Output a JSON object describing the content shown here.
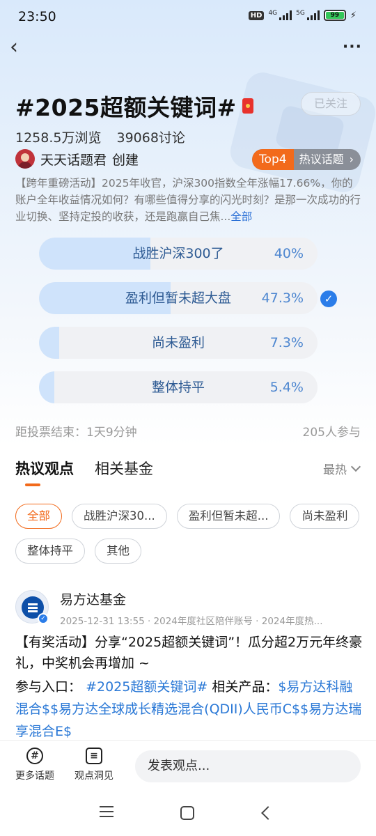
{
  "status_bar": {
    "time": "23:50",
    "hd": "HD",
    "net1": "4G",
    "net2": "5G",
    "battery": "99"
  },
  "topic": {
    "title": "#2025超额关键词#",
    "follow_label": "已关注",
    "views": "1258.5万浏览",
    "discussions": "39068讨论",
    "creator_name": "天天话题君",
    "creator_suffix": "创建",
    "rank": "Top4",
    "rank_label": "热议话题",
    "description": "【跨年重磅活动】2025年收官，沪深300指数全年涨幅17.66%，你的账户全年收益情况如何？有哪些值得分享的闪光时刻？是那一次成功的行业切换、坚持定投的收获，还是跑赢自己焦...",
    "more_label": "全部"
  },
  "poll": {
    "options": [
      {
        "label": "战胜沪深300了",
        "percent_text": "40%",
        "value": 0.4,
        "selected": false
      },
      {
        "label": "盈利但暂未超大盘",
        "percent_text": "47.3%",
        "value": 0.473,
        "selected": true
      },
      {
        "label": "尚未盈利",
        "percent_text": "7.3%",
        "value": 0.073,
        "selected": false
      },
      {
        "label": "整体持平",
        "percent_text": "5.4%",
        "value": 0.054,
        "selected": false
      }
    ],
    "deadline": "距投票结束：1天9分钟",
    "participants": "205人参与"
  },
  "tabs": {
    "hot": "热议观点",
    "funds": "相关基金",
    "sort": "最热"
  },
  "filters": [
    "全部",
    "战胜沪深30...",
    "盈利但暂未超...",
    "尚未盈利",
    "整体持平",
    "其他"
  ],
  "post": {
    "author": "易方达基金",
    "meta": "2025-12-31 13:55 · 2024年度社区陪伴账号 · 2024年度热...",
    "line1": "【有奖活动】分享“2025超额关键词”！瓜分超2万元年终豪礼，中奖机会再增加 ~",
    "entry_label": "参与入口：",
    "entry_topic": "#2025超额关键词#",
    "products_label": "相关产品：",
    "products": "$易方达科融混合$$易方达全球成长精选混合(QDII)人民币C$$易方达瑞享混合E$"
  },
  "bottom_bar": {
    "more_topics": "更多话题",
    "insights": "观点洞见",
    "compose_placeholder": "发表观点..."
  },
  "colors": {
    "accent": "#f26a1b",
    "link": "#2a78d6",
    "poll_fill": "#cfe3fb",
    "poll_bg": "#f0f1f4"
  }
}
